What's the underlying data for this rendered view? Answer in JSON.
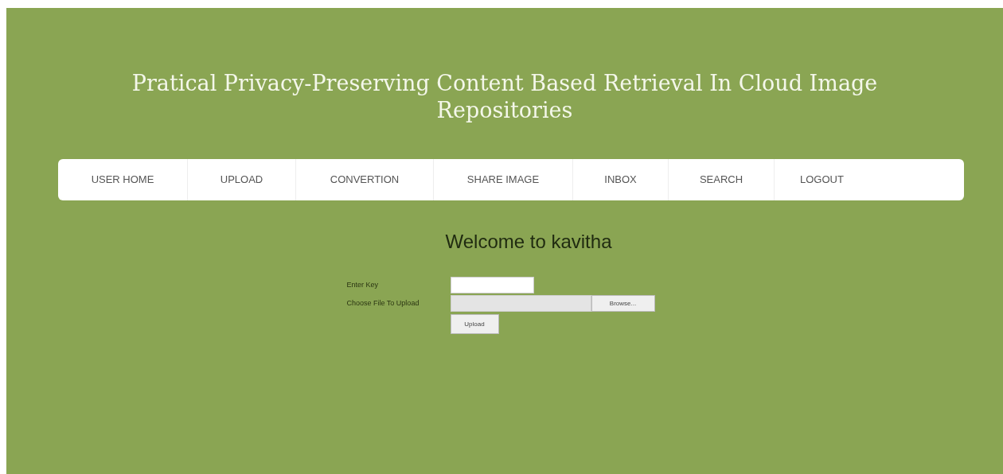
{
  "header": {
    "title": "Pratical Privacy-Preserving Content Based Retrieval In Cloud Image Repositories"
  },
  "nav": {
    "items": [
      {
        "label": "USER HOME"
      },
      {
        "label": "UPLOAD"
      },
      {
        "label": "CONVERTION"
      },
      {
        "label": "SHARE IMAGE"
      },
      {
        "label": "INBOX"
      },
      {
        "label": "SEARCH"
      },
      {
        "label": "LOGOUT"
      }
    ]
  },
  "welcome": "Welcome to kavitha",
  "form": {
    "key_label": "Enter Key",
    "file_label": "Choose File To Upload",
    "browse_button": "Browse...",
    "submit_button": "Upload"
  }
}
